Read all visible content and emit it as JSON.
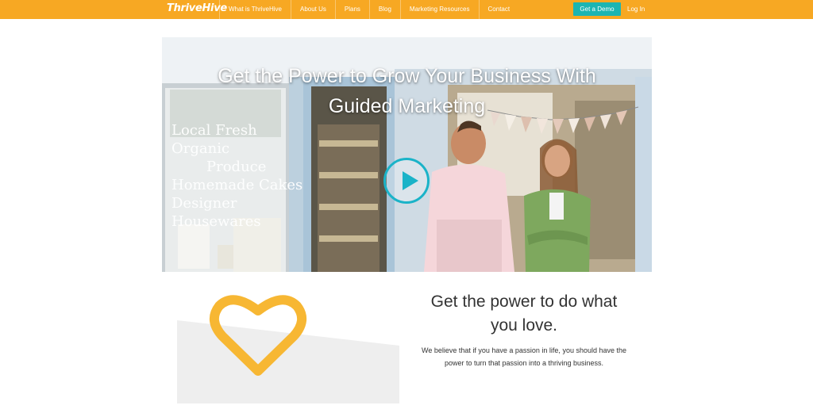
{
  "brand": {
    "logo": "ThriveHive",
    "accent": "#f7a823",
    "teal": "#1cb5b2"
  },
  "nav": {
    "items": [
      "What is ThriveHive",
      "About Us",
      "Plans",
      "Blog",
      "Marketing Resources",
      "Contact"
    ],
    "demo_label": "Get a Demo",
    "login_label": "Log In"
  },
  "hero": {
    "title_line1": "Get the Power to Grow Your Business With",
    "title_line2": "Guided Marketing",
    "window_text_1": "Local Fresh Organic",
    "window_text_2": "Produce",
    "window_text_3": "Homemade Cakes",
    "window_text_4": "Designer Housewares",
    "play_icon": "play-icon"
  },
  "feature": {
    "icon": "heart-icon",
    "heading_line1": "Get the power to do what",
    "heading_line2": "you love.",
    "body_line1": "We believe that if you have a passion in life, you should have the",
    "body_line2": "power to turn that passion into a thriving business."
  }
}
